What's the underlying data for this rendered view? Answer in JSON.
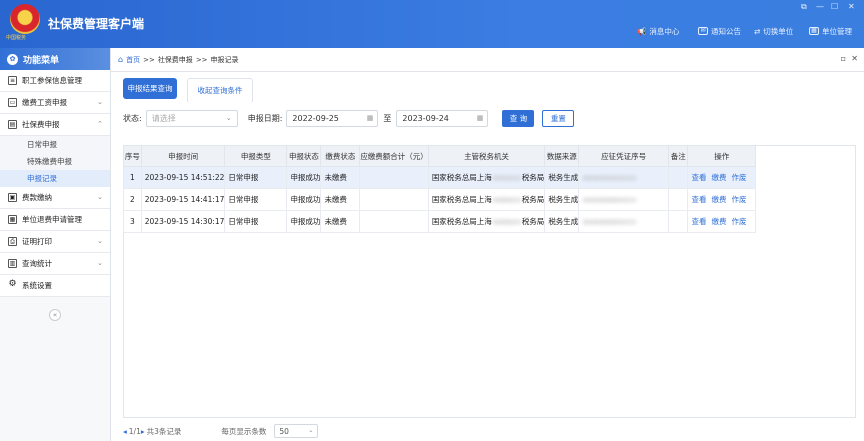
{
  "app": {
    "title": "社保费管理客户端",
    "emblem_text": "中国税务",
    "window_controls": [
      "⧉",
      "—",
      "☐",
      "✕"
    ]
  },
  "header_links": [
    {
      "label": "消息中心",
      "icon": "megaphone-icon"
    },
    {
      "label": "通知公告",
      "icon": "mail-icon"
    },
    {
      "label": "切换单位",
      "icon": "switch-icon"
    },
    {
      "label": "单位管理",
      "icon": "building-icon"
    }
  ],
  "sidebar": {
    "title": "功能菜单",
    "items": [
      {
        "label": "职工参保信息管理",
        "chevron": ""
      },
      {
        "label": "缴费工资申报",
        "chevron": "⌄"
      },
      {
        "label": "社保费申报",
        "chevron": "⌃"
      },
      {
        "label": "日常申报",
        "sub": true
      },
      {
        "label": "特殊缴费申报",
        "sub": true
      },
      {
        "label": "申报记录",
        "sub": true,
        "active": true
      },
      {
        "label": "费款缴纳",
        "chevron": "⌄"
      },
      {
        "label": "单位退费申请管理",
        "chevron": ""
      },
      {
        "label": "证明打印",
        "chevron": "⌄"
      },
      {
        "label": "查询统计",
        "chevron": "⌄"
      },
      {
        "label": "系统设置",
        "chevron": ""
      }
    ],
    "collapse_symbol": "«"
  },
  "breadcrumb": {
    "home": "首页",
    "sep": ">>",
    "level1": "社保费申报",
    "level2": "申报记录"
  },
  "tabs": {
    "primary": "申报结果查询",
    "secondary": "收起查询条件"
  },
  "filter": {
    "status_label": "状态:",
    "status_placeholder": "请选择",
    "date_label": "申报日期:",
    "date_from": "2022-09-25",
    "to_label": "至",
    "date_to": "2023-09-24",
    "query_button": "查 询",
    "reset_button": "重置"
  },
  "table": {
    "headers": [
      "序号",
      "申报时间",
      "申报类型",
      "申报状态",
      "缴费状态",
      "应缴费额合计（元）",
      "主管税务机关",
      "数据来源",
      "应征凭证序号",
      "备注",
      "操作"
    ],
    "rows": [
      {
        "no": "1",
        "time": "2023-09-15 14:51:22",
        "type": "日常申报",
        "declare_status": "申报成功",
        "pay_status": "未缴费",
        "amount": "",
        "tax_office_a": "国家税务总局上海",
        "tax_office_b": "税务局",
        "source": "税务生成",
        "voucher": "",
        "remark": "",
        "ops": [
          "查看",
          "缴费",
          "作废"
        ]
      },
      {
        "no": "2",
        "time": "2023-09-15 14:41:17",
        "type": "日常申报",
        "declare_status": "申报成功",
        "pay_status": "未缴费",
        "amount": "",
        "tax_office_a": "国家税务总局上海",
        "tax_office_b": "税务局",
        "source": "税务生成",
        "voucher": "",
        "remark": "",
        "ops": [
          "查看",
          "缴费",
          "作废"
        ]
      },
      {
        "no": "3",
        "time": "2023-09-15 14:30:17",
        "type": "日常申报",
        "declare_status": "申报成功",
        "pay_status": "未缴费",
        "amount": "",
        "tax_office_a": "国家税务总局上海",
        "tax_office_b": "税务局",
        "source": "税务生成",
        "voucher": "",
        "remark": "",
        "ops": [
          "查看",
          "缴费",
          "作废"
        ]
      }
    ]
  },
  "pager": {
    "page": "1/1",
    "total": "共3条记录",
    "per_page_label": "每页显示条数",
    "per_page": "50"
  },
  "colors": {
    "primary": "#2f6fd6",
    "selected_row": "#e9f0fc"
  }
}
